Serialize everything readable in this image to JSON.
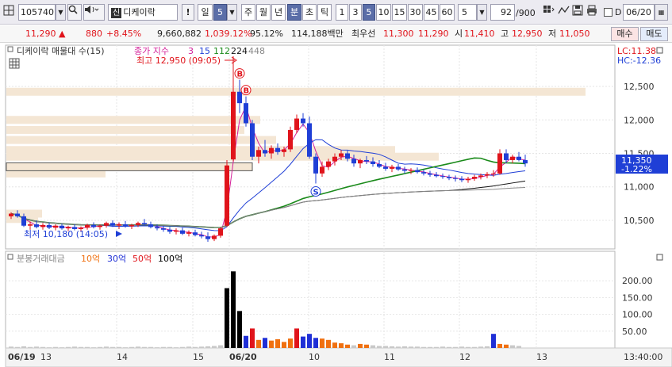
{
  "toolbar": {
    "code": "105740",
    "name_tag": "신",
    "name": "디케이락",
    "period_day": "일",
    "period_day_n": "5",
    "period_week": "주",
    "period_month": "월",
    "period_year": "년",
    "period_minute": "분",
    "period_second": "초",
    "period_tick": "틱",
    "intervals": [
      "1",
      "3",
      "5",
      "10",
      "15",
      "30",
      "45",
      "60"
    ],
    "interval_selected": "5",
    "interval_combo": "5",
    "count": "92",
    "count_total": "/900",
    "date": "06/20",
    "checkbox_label": "D",
    "icons": [
      "search-icon",
      "speaker-icon",
      "alert-icon",
      "grid-icon",
      "line-tool-icon",
      "save-icon",
      "print-icon"
    ]
  },
  "quote": {
    "price": "11,290",
    "change": "880",
    "change_pct": "+8.45%",
    "volume": "9,660,882",
    "volume_ratio": "1,039.12%",
    "strength": "95.12%",
    "amount": "114,188백만",
    "best_sell_label": "최우선",
    "best_sell": "11,300",
    "best_buy": "11,290",
    "open_label": "시",
    "open": "11,410",
    "high_label": "고",
    "high": "12,950",
    "low_label": "저",
    "low": "11,050",
    "buy_label": "매수",
    "sell_label": "매도"
  },
  "price_panel": {
    "title": "디케이락 매물대 수(15)",
    "ma_legend_label": "종가 지수",
    "ma_periods": [
      "3",
      "15",
      "112",
      "224",
      "448"
    ],
    "ma_colors": [
      "#d4209a",
      "#1f3fd6",
      "#1a8a1a",
      "#111111",
      "#888888"
    ],
    "high_annotation": "최고 12,950 (09:05)",
    "low_annotation": "최저 10,180 (14:05)",
    "lc_label": "LC:11.38",
    "hc_label": "HC:-12.36",
    "current_price_tag": "11,350",
    "current_change_tag": "-1.22%",
    "y_ticks": [
      "12,500",
      "12,000",
      "11,500",
      "11,000",
      "10,500"
    ],
    "signal_buy": "B",
    "signal_sell": "S"
  },
  "volume_panel": {
    "title": "분봉거래대금",
    "legend": [
      {
        "label": "10억",
        "color": "#f07010"
      },
      {
        "label": "30억",
        "color": "#1f2fd6"
      },
      {
        "label": "50억",
        "color": "#e0141b"
      },
      {
        "label": "100억",
        "color": "#000000"
      }
    ],
    "y_ticks": [
      "200.00",
      "150.00",
      "100.00",
      "50.00"
    ]
  },
  "time_axis": {
    "labels": [
      "06/19",
      "13",
      "14",
      "15",
      "06/20",
      "10",
      "11",
      "12",
      "13"
    ],
    "current_time": "13:40:00"
  },
  "chart_data": {
    "type": "candlestick",
    "price_ylim": [
      10180,
      12950
    ],
    "bars": [
      {
        "o": 10560,
        "h": 10620,
        "l": 10520,
        "c": 10600
      },
      {
        "o": 10600,
        "h": 10650,
        "l": 10540,
        "c": 10560
      },
      {
        "o": 10560,
        "h": 10600,
        "l": 10400,
        "c": 10420
      },
      {
        "o": 10420,
        "h": 10480,
        "l": 10360,
        "c": 10440
      },
      {
        "o": 10440,
        "h": 10500,
        "l": 10380,
        "c": 10400
      },
      {
        "o": 10400,
        "h": 10460,
        "l": 10360,
        "c": 10430
      },
      {
        "o": 10430,
        "h": 10470,
        "l": 10370,
        "c": 10390
      },
      {
        "o": 10390,
        "h": 10440,
        "l": 10350,
        "c": 10420
      },
      {
        "o": 10420,
        "h": 10450,
        "l": 10360,
        "c": 10380
      },
      {
        "o": 10380,
        "h": 10420,
        "l": 10340,
        "c": 10400
      },
      {
        "o": 10400,
        "h": 10440,
        "l": 10350,
        "c": 10370
      },
      {
        "o": 10370,
        "h": 10410,
        "l": 10330,
        "c": 10390
      },
      {
        "o": 10390,
        "h": 10450,
        "l": 10360,
        "c": 10430
      },
      {
        "o": 10430,
        "h": 10470,
        "l": 10380,
        "c": 10400
      },
      {
        "o": 10400,
        "h": 10440,
        "l": 10360,
        "c": 10420
      },
      {
        "o": 10420,
        "h": 10480,
        "l": 10390,
        "c": 10460
      },
      {
        "o": 10460,
        "h": 10500,
        "l": 10400,
        "c": 10420
      },
      {
        "o": 10420,
        "h": 10470,
        "l": 10370,
        "c": 10440
      },
      {
        "o": 10440,
        "h": 10490,
        "l": 10390,
        "c": 10410
      },
      {
        "o": 10410,
        "h": 10450,
        "l": 10370,
        "c": 10430
      },
      {
        "o": 10430,
        "h": 10480,
        "l": 10400,
        "c": 10460
      },
      {
        "o": 10460,
        "h": 10520,
        "l": 10420,
        "c": 10440
      },
      {
        "o": 10440,
        "h": 10480,
        "l": 10380,
        "c": 10400
      },
      {
        "o": 10400,
        "h": 10440,
        "l": 10350,
        "c": 10380
      },
      {
        "o": 10380,
        "h": 10420,
        "l": 10330,
        "c": 10360
      },
      {
        "o": 10360,
        "h": 10400,
        "l": 10300,
        "c": 10330
      },
      {
        "o": 10330,
        "h": 10380,
        "l": 10290,
        "c": 10350
      },
      {
        "o": 10350,
        "h": 10390,
        "l": 10280,
        "c": 10300
      },
      {
        "o": 10300,
        "h": 10350,
        "l": 10260,
        "c": 10320
      },
      {
        "o": 10320,
        "h": 10360,
        "l": 10260,
        "c": 10280
      },
      {
        "o": 10280,
        "h": 10330,
        "l": 10230,
        "c": 10260
      },
      {
        "o": 10260,
        "h": 10320,
        "l": 10180,
        "c": 10220
      },
      {
        "o": 10220,
        "h": 10290,
        "l": 10190,
        "c": 10270
      },
      {
        "o": 10270,
        "h": 10400,
        "l": 10240,
        "c": 10380
      },
      {
        "o": 10420,
        "h": 11400,
        "l": 10400,
        "c": 11320
      },
      {
        "o": 11410,
        "h": 12950,
        "l": 11380,
        "c": 12420
      },
      {
        "o": 12420,
        "h": 12600,
        "l": 12100,
        "c": 12250
      },
      {
        "o": 12250,
        "h": 12350,
        "l": 11900,
        "c": 11950
      },
      {
        "o": 11950,
        "h": 12000,
        "l": 11400,
        "c": 11450
      },
      {
        "o": 11450,
        "h": 11600,
        "l": 11350,
        "c": 11550
      },
      {
        "o": 11550,
        "h": 11700,
        "l": 11450,
        "c": 11500
      },
      {
        "o": 11500,
        "h": 11620,
        "l": 11420,
        "c": 11580
      },
      {
        "o": 11580,
        "h": 11650,
        "l": 11480,
        "c": 11520
      },
      {
        "o": 11520,
        "h": 11600,
        "l": 11450,
        "c": 11560
      },
      {
        "o": 11560,
        "h": 11900,
        "l": 11520,
        "c": 11850
      },
      {
        "o": 11850,
        "h": 12080,
        "l": 11800,
        "c": 12020
      },
      {
        "o": 12020,
        "h": 12100,
        "l": 11900,
        "c": 11950
      },
      {
        "o": 11950,
        "h": 12050,
        "l": 11420,
        "c": 11450
      },
      {
        "o": 11450,
        "h": 11500,
        "l": 11050,
        "c": 11200
      },
      {
        "o": 11200,
        "h": 11380,
        "l": 11150,
        "c": 11300
      },
      {
        "o": 11300,
        "h": 11420,
        "l": 11250,
        "c": 11380
      },
      {
        "o": 11380,
        "h": 11500,
        "l": 11320,
        "c": 11450
      },
      {
        "o": 11450,
        "h": 11550,
        "l": 11400,
        "c": 11500
      },
      {
        "o": 11500,
        "h": 11540,
        "l": 11380,
        "c": 11420
      },
      {
        "o": 11420,
        "h": 11480,
        "l": 11300,
        "c": 11350
      },
      {
        "o": 11350,
        "h": 11420,
        "l": 11280,
        "c": 11400
      },
      {
        "o": 11400,
        "h": 11460,
        "l": 11340,
        "c": 11380
      },
      {
        "o": 11380,
        "h": 11440,
        "l": 11300,
        "c": 11340
      },
      {
        "o": 11340,
        "h": 11400,
        "l": 11280,
        "c": 11300
      },
      {
        "o": 11300,
        "h": 11360,
        "l": 11240,
        "c": 11270
      },
      {
        "o": 11270,
        "h": 11330,
        "l": 11220,
        "c": 11300
      },
      {
        "o": 11300,
        "h": 11340,
        "l": 11240,
        "c": 11260
      },
      {
        "o": 11260,
        "h": 11300,
        "l": 11200,
        "c": 11240
      },
      {
        "o": 11240,
        "h": 11280,
        "l": 11190,
        "c": 11250
      },
      {
        "o": 11250,
        "h": 11290,
        "l": 11200,
        "c": 11220
      },
      {
        "o": 11220,
        "h": 11260,
        "l": 11170,
        "c": 11200
      },
      {
        "o": 11200,
        "h": 11240,
        "l": 11150,
        "c": 11180
      },
      {
        "o": 11180,
        "h": 11220,
        "l": 11140,
        "c": 11160
      },
      {
        "o": 11160,
        "h": 11200,
        "l": 11120,
        "c": 11150
      },
      {
        "o": 11150,
        "h": 11180,
        "l": 11100,
        "c": 11130
      },
      {
        "o": 11130,
        "h": 11170,
        "l": 11080,
        "c": 11120
      },
      {
        "o": 11120,
        "h": 11160,
        "l": 11070,
        "c": 11100
      },
      {
        "o": 11100,
        "h": 11150,
        "l": 11060,
        "c": 11120
      },
      {
        "o": 11120,
        "h": 11180,
        "l": 11090,
        "c": 11150
      },
      {
        "o": 11150,
        "h": 11200,
        "l": 11110,
        "c": 11170
      },
      {
        "o": 11170,
        "h": 11220,
        "l": 11130,
        "c": 11190
      },
      {
        "o": 11190,
        "h": 11250,
        "l": 11150,
        "c": 11200
      },
      {
        "o": 11200,
        "h": 11560,
        "l": 11180,
        "c": 11500
      },
      {
        "o": 11500,
        "h": 11560,
        "l": 11350,
        "c": 11400
      },
      {
        "o": 11400,
        "h": 11480,
        "l": 11350,
        "c": 11450
      },
      {
        "o": 11450,
        "h": 11520,
        "l": 11380,
        "c": 11400
      },
      {
        "o": 11400,
        "h": 11480,
        "l": 11300,
        "c": 11350
      }
    ],
    "volume_values": [
      4,
      3,
      5,
      3,
      4,
      3,
      2,
      3,
      2,
      3,
      4,
      3,
      3,
      2,
      3,
      4,
      3,
      3,
      2,
      3,
      4,
      3,
      3,
      2,
      3,
      3,
      2,
      3,
      4,
      3,
      4,
      5,
      6,
      8,
      178,
      228,
      110,
      36,
      58,
      24,
      30,
      22,
      26,
      18,
      28,
      58,
      34,
      42,
      30,
      28,
      24,
      16,
      14,
      10,
      8,
      12,
      10,
      8,
      6,
      6,
      5,
      4,
      5,
      4,
      4,
      3,
      3,
      3,
      4,
      3,
      3,
      4,
      3,
      3,
      4,
      5,
      42,
      12,
      10,
      8,
      6
    ],
    "volume_ylim": [
      0,
      250
    ]
  }
}
